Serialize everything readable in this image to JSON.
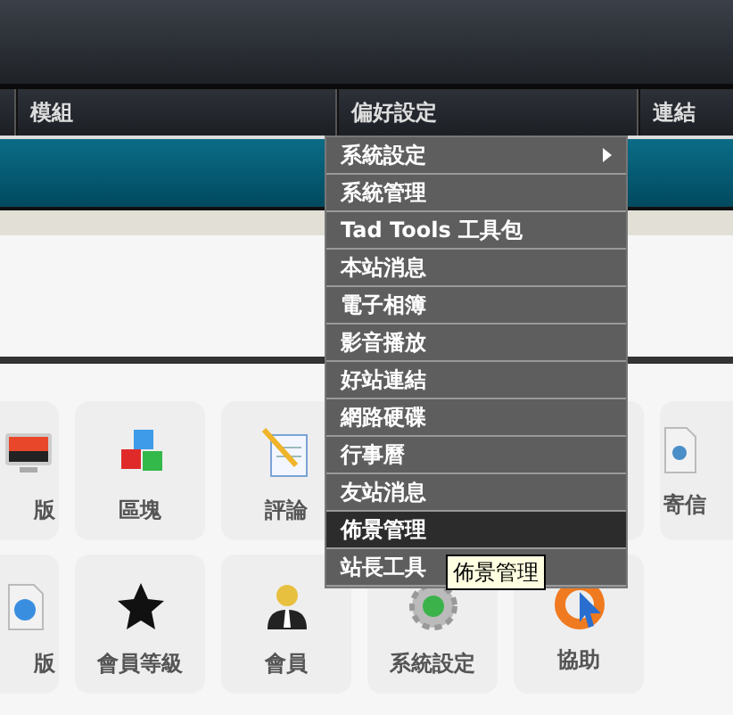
{
  "nav": [
    {
      "label": "模組"
    },
    {
      "label": "偏好設定"
    },
    {
      "label": "連結"
    }
  ],
  "tiles": [
    [
      {
        "kind": "monitor",
        "label": "版"
      },
      {
        "kind": "blocks",
        "label": "區塊"
      },
      {
        "kind": "notepad",
        "label": "評論"
      },
      {
        "kind": "hidden"
      },
      {
        "kind": "blank"
      },
      {
        "kind": "mail",
        "label": "寄信"
      }
    ],
    [
      {
        "kind": "globe",
        "label": "版"
      },
      {
        "kind": "star",
        "label": "會員等級"
      },
      {
        "kind": "person",
        "label": "會員"
      },
      {
        "kind": "gear",
        "label": "系統設定"
      },
      {
        "kind": "help",
        "label": "協助"
      }
    ]
  ],
  "menu": [
    {
      "label": "系統設定",
      "selected": false,
      "submenu": true
    },
    {
      "label": "系統管理",
      "selected": false
    },
    {
      "label": "Tad Tools 工具包",
      "selected": false
    },
    {
      "label": "本站消息",
      "selected": false
    },
    {
      "label": "電子相簿",
      "selected": false
    },
    {
      "label": "影音播放",
      "selected": false
    },
    {
      "label": "好站連結",
      "selected": false
    },
    {
      "label": "網路硬碟",
      "selected": false
    },
    {
      "label": "行事曆",
      "selected": false
    },
    {
      "label": "友站消息",
      "selected": false
    },
    {
      "label": "佈景管理",
      "selected": true
    },
    {
      "label": "站長工具",
      "selected": false
    }
  ],
  "tooltip": "佈景管理"
}
